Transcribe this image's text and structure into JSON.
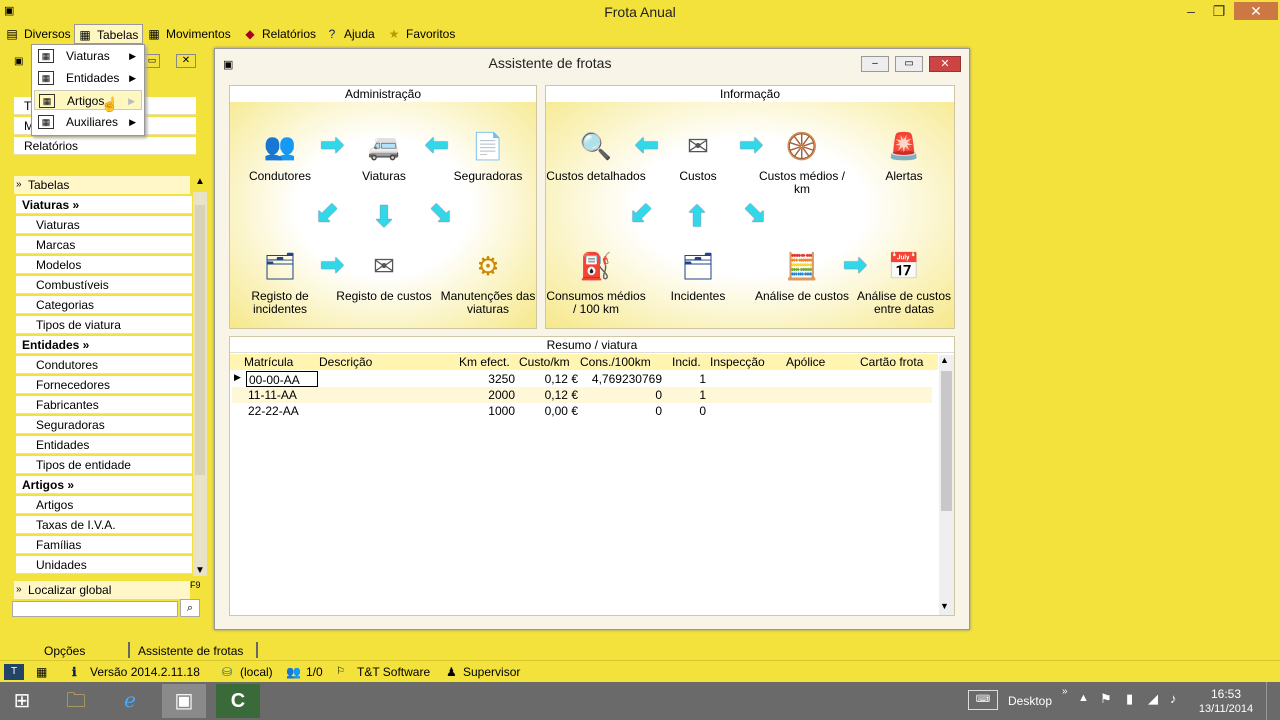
{
  "window": {
    "title": "Frota Anual"
  },
  "menubar": [
    {
      "label": "Diversos",
      "icon": "diversos-icon"
    },
    {
      "label": "Tabelas",
      "icon": "table-icon"
    },
    {
      "label": "Movimentos",
      "icon": "table-icon"
    },
    {
      "label": "Relatórios",
      "icon": "reports-icon"
    },
    {
      "label": "Ajuda",
      "icon": "help-icon"
    },
    {
      "label": "Favoritos",
      "icon": "star-icon"
    }
  ],
  "dropdown": [
    {
      "label": "Viaturas"
    },
    {
      "label": "Entidades"
    },
    {
      "label": "Artigos"
    },
    {
      "label": "Auxiliares"
    }
  ],
  "leftpanel": {
    "top_items": [
      "T",
      "M",
      "Relatórios"
    ],
    "section": "Tabelas",
    "items": [
      {
        "label": "Viaturas »",
        "type": "head"
      },
      {
        "label": "Viaturas",
        "type": "sub"
      },
      {
        "label": "Marcas",
        "type": "sub"
      },
      {
        "label": "Modelos",
        "type": "sub"
      },
      {
        "label": "Combustíveis",
        "type": "sub"
      },
      {
        "label": "Categorias",
        "type": "sub"
      },
      {
        "label": "Tipos de viatura",
        "type": "sub"
      },
      {
        "label": "Entidades »",
        "type": "head"
      },
      {
        "label": "Condutores",
        "type": "sub"
      },
      {
        "label": "Fornecedores",
        "type": "sub"
      },
      {
        "label": "Fabricantes",
        "type": "sub"
      },
      {
        "label": "Seguradoras",
        "type": "sub"
      },
      {
        "label": "Entidades",
        "type": "sub"
      },
      {
        "label": "Tipos de entidade",
        "type": "sub"
      },
      {
        "label": "Artigos »",
        "type": "head"
      },
      {
        "label": "Artigos",
        "type": "sub"
      },
      {
        "label": "Taxas de I.V.A.",
        "type": "sub"
      },
      {
        "label": "Famílias",
        "type": "sub"
      },
      {
        "label": "Unidades",
        "type": "sub"
      }
    ],
    "f9": "F9",
    "search_label": "Localizar global"
  },
  "main": {
    "title": "Assistente de frotas",
    "admin": {
      "title": "Administração",
      "items": [
        "Condutores",
        "Viaturas",
        "Seguradoras",
        "Registo de incidentes",
        "Registo de custos",
        "Manutenções das viaturas"
      ]
    },
    "info": {
      "title": "Informação",
      "items": [
        "Custos detalhados",
        "Custos",
        "Custos médios / km",
        "Alertas",
        "Consumos médios / 100 km",
        "Incidentes",
        "Análise de custos",
        "Análise de custos entre datas"
      ]
    },
    "resumo": {
      "title": "Resumo / viatura",
      "columns": [
        "Matrícula",
        "Descrição",
        "Km efect.",
        "Custo/km",
        "Cons./100km",
        "Incid.",
        "Inspecção",
        "Apólice",
        "Cartão frota"
      ],
      "rows": [
        [
          "00-00-AA",
          "",
          "3250",
          "0,12 €",
          "4,769230769",
          "1",
          "",
          "",
          ""
        ],
        [
          "11-11-AA",
          "",
          "2000",
          "0,12 €",
          "0",
          "1",
          "",
          "",
          ""
        ],
        [
          "22-22-AA",
          "",
          "1000",
          "0,00 €",
          "0",
          "0",
          "",
          "",
          ""
        ]
      ]
    }
  },
  "bottombar": {
    "tabs": [
      "Opções",
      "Assistente de frotas"
    ]
  },
  "statusbar": {
    "version": "Versão 2014.2.11.18",
    "db": "(local)",
    "users": "1/0",
    "company": "T&T Software",
    "user": "Supervisor"
  },
  "taskbar": {
    "desktop_label": "Desktop",
    "time": "16:53",
    "date": "13/11/2014"
  },
  "colors": {
    "accent": "#f4e23c",
    "arrow": "#33d8e8"
  }
}
